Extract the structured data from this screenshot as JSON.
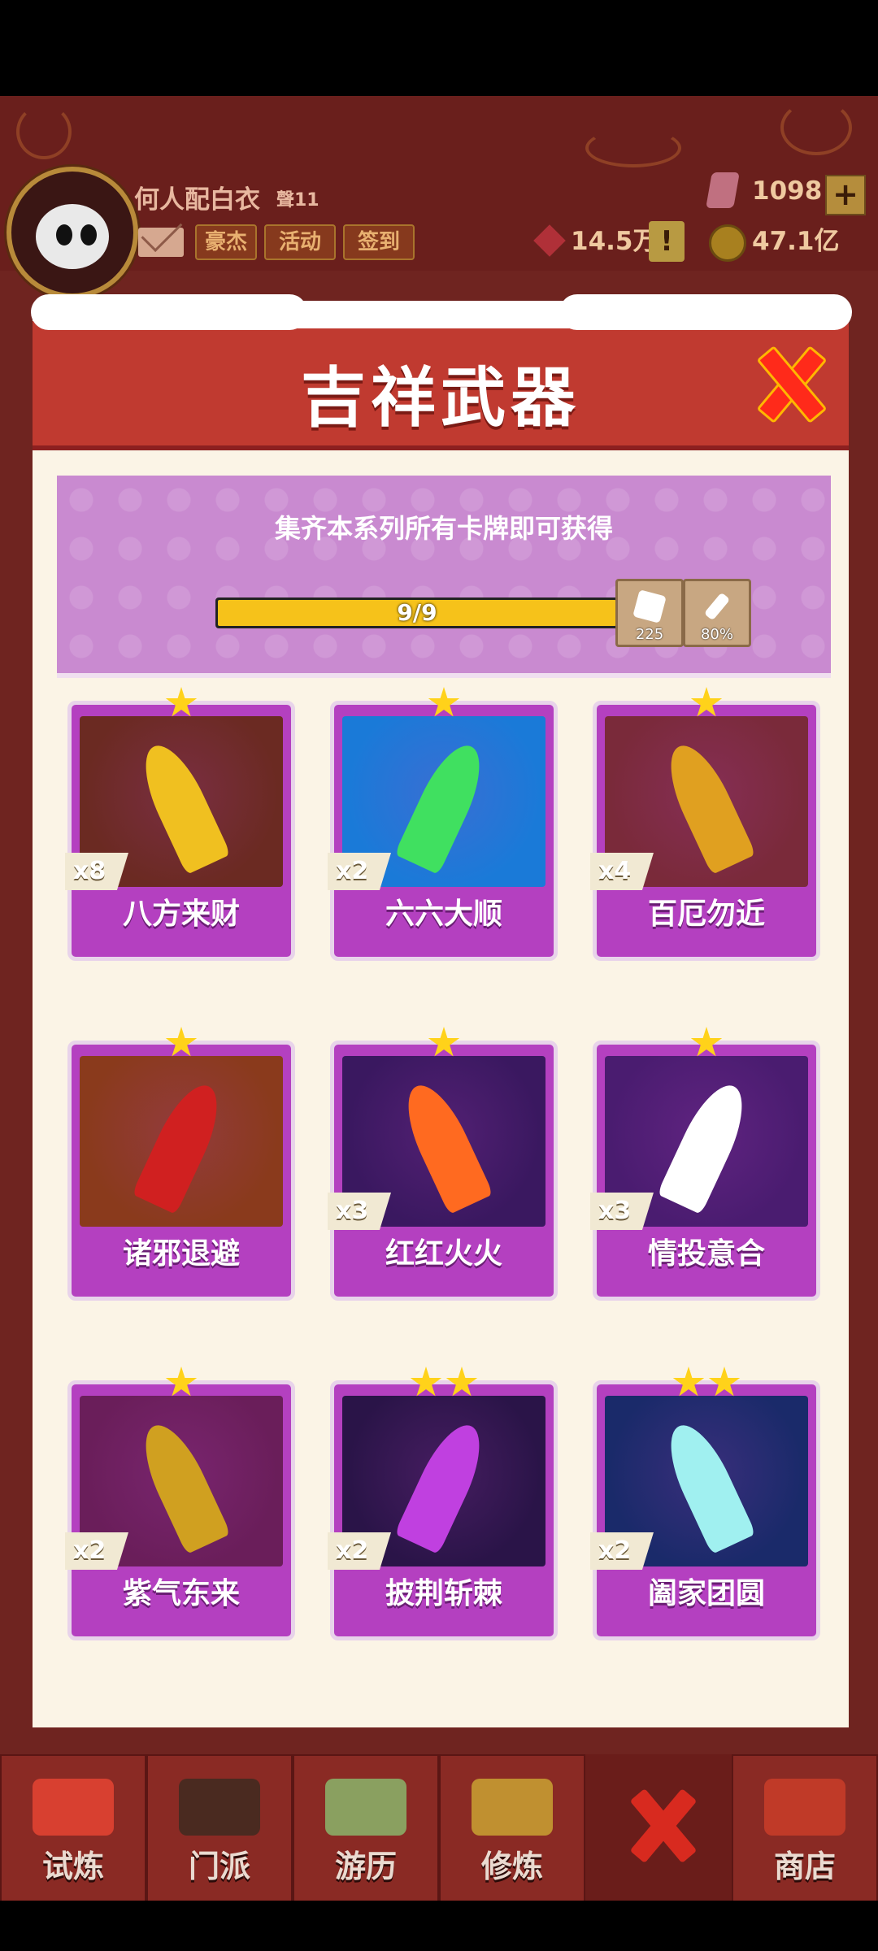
{
  "hud": {
    "username": "何人配白衣",
    "level": "聲11",
    "buttons": [
      "豪杰",
      "活动",
      "签到"
    ],
    "gems": "1098",
    "power": "14.5万",
    "gold": "47.1亿",
    "plus": "+",
    "warning": "!"
  },
  "dialog": {
    "title": "吉祥武器",
    "banner_text": "集齐本系列所有卡牌即可获得",
    "progress_text": "9/9",
    "progress_value": 1.0,
    "rewards": [
      {
        "icon": "dice-icon",
        "label": "225"
      },
      {
        "icon": "sword-icon",
        "label": "80%"
      }
    ]
  },
  "cards": [
    {
      "name": "八方来财",
      "count": "x8",
      "stars": 1,
      "colors": [
        "#6b2a22",
        "#f0c020"
      ]
    },
    {
      "name": "六六大顺",
      "count": "x2",
      "stars": 1,
      "colors": [
        "#1a7ad8",
        "#40e060"
      ]
    },
    {
      "name": "百厄勿近",
      "count": "x4",
      "stars": 1,
      "colors": [
        "#7a2a3a",
        "#e0a020"
      ]
    },
    {
      "name": "诸邪退避",
      "count": "",
      "stars": 1,
      "colors": [
        "#8a3a1c",
        "#d02020"
      ]
    },
    {
      "name": "红红火火",
      "count": "x3",
      "stars": 1,
      "colors": [
        "#3a1860",
        "#ff6a20"
      ]
    },
    {
      "name": "情投意合",
      "count": "x3",
      "stars": 1,
      "colors": [
        "#4a1c70",
        "#ffffff"
      ]
    },
    {
      "name": "紫气东来",
      "count": "x2",
      "stars": 1,
      "colors": [
        "#6a1e5a",
        "#d0a020"
      ]
    },
    {
      "name": "披荆斩棘",
      "count": "x2",
      "stars": 2,
      "colors": [
        "#2a1448",
        "#c040e0"
      ]
    },
    {
      "name": "阖家团圆",
      "count": "x2",
      "stars": 2,
      "colors": [
        "#1a2a6a",
        "#a0f0f0"
      ]
    }
  ],
  "nav": {
    "items": [
      "试炼",
      "门派",
      "游历",
      "修炼",
      "",
      "商店"
    ]
  }
}
